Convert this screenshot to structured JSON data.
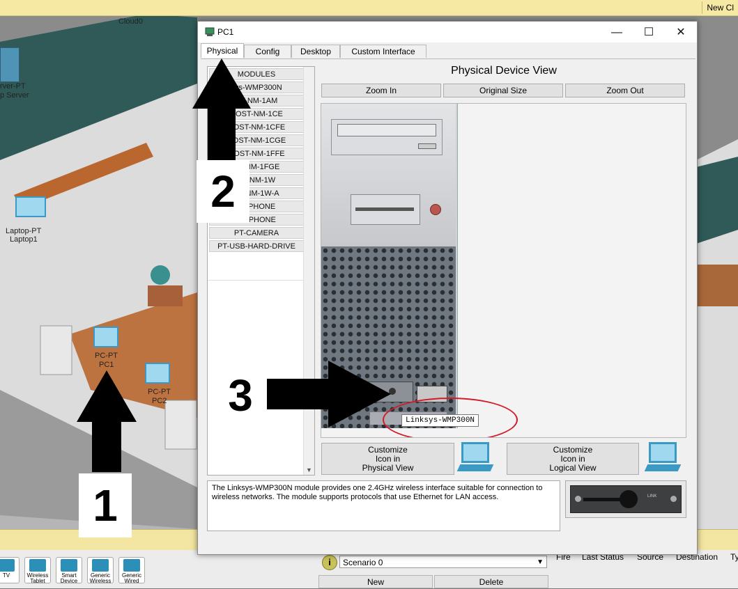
{
  "workspace": {
    "new_cluster": "New Cl",
    "cloud_label": "Cloud0",
    "server_label_1": "rver-PT",
    "server_label_2": "p Server",
    "laptop_label_1": "Laptop-PT",
    "laptop_label_2": "Laptop1",
    "pc1_label_1": "PC-PT",
    "pc1_label_2": "PC1",
    "pc2_label_1": "PC-PT",
    "pc2_label_2": "PC2"
  },
  "device_bar": {
    "items": [
      "TV",
      "Wireless Tablet",
      "Smart Device",
      "Generic Wireless",
      "Generic Wired"
    ]
  },
  "scenario": {
    "info_icon": "i",
    "selected": "Scenario 0",
    "new_label": "New",
    "delete_label": "Delete"
  },
  "pdu_headers": [
    "Fire",
    "Last Status",
    "Source",
    "Destination",
    "Ty"
  ],
  "window": {
    "title": "PC1",
    "minimize_icon": "—",
    "maximize_icon": "☐",
    "close_icon": "✕",
    "tabs": [
      "Physical",
      "Config",
      "Desktop",
      "Custom Interface"
    ],
    "active_tab": "Physical"
  },
  "modules": {
    "items": [
      "MODULES",
      "sys-WMP300N",
      "ST-NM-1AM",
      "HOST-NM-1CE",
      "HOST-NM-1CFE",
      "HOST-NM-1CGE",
      "HOST-NM-1FFE",
      "ST-NM-1FGE",
      "ST-NM-1W",
      "ST-NM-1W-A",
      "ADPHONE",
      "ROPHONE",
      "PT-CAMERA",
      "PT-USB-HARD-DRIVE"
    ]
  },
  "physical_view": {
    "title": "Physical Device View",
    "zoom_in": "Zoom In",
    "original_size": "Original Size",
    "zoom_out": "Zoom Out",
    "tooltip": "Linksys-WMP300N",
    "customize_physical": [
      "Customize",
      "Icon in",
      "Physical View"
    ],
    "customize_logical": [
      "Customize",
      "Icon in",
      "Logical View"
    ]
  },
  "description": "The Linksys-WMP300N module provides one 2.4GHz wireless interface suitable for connection to wireless networks. The module supports protocols that use Ethernet for LAN access.",
  "module_image": {
    "plate_text": "LINK"
  },
  "annotations": {
    "one": "1",
    "two": "2",
    "three": "3"
  },
  "colors": {
    "annotation_circle": "#d21c2a",
    "title_bar_yellow": "#f6e9a4",
    "pc_icon": "#3b9ac5"
  }
}
